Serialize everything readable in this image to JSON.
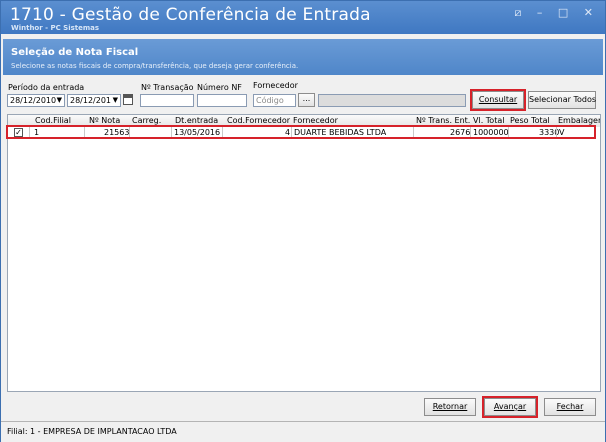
{
  "window": {
    "title": "1710 - Gestão de Conferência de Entrada",
    "subtitle": "Winthor - PC Sistemas",
    "controls": [
      "⧄",
      "–",
      "□",
      "✕"
    ]
  },
  "section": {
    "title": "Seleção de Nota Fiscal",
    "description": "Selecione as notas fiscais de compra/transferência, que deseja gerar conferência."
  },
  "filters": {
    "periodo_label": "Período da entrada",
    "date_start": "28/12/2010",
    "date_end": "28/12/201",
    "transacao_label": "Nº Transação",
    "transacao_value": "",
    "numero_nf_label": "Número NF",
    "numero_nf_value": "",
    "fornecedor_label": "Fornecedor",
    "fornecedor_placeholder": "Código",
    "ellipsis": "...",
    "fornecedor_name": ""
  },
  "buttons": {
    "consultar": "Consultar",
    "selecionar_todos": "Selecionar Todos",
    "retornar": "Retornar",
    "avancar": "Avançar",
    "fechar": "Fechar"
  },
  "table": {
    "columns": [
      "Cod.Filial",
      "Nº Nota",
      "Carreg.",
      "Dt.entrada",
      "Cod.Fornecedor",
      "Fornecedor",
      "Nº Trans. Ent.",
      "Vl. Total",
      "Peso Total",
      "Embalagem"
    ],
    "rows": [
      {
        "checked": true,
        "cod_filial": "1",
        "nota": "21563",
        "carreg": "",
        "dt_entrada": "13/05/2016",
        "cod_fornecedor": "4",
        "fornecedor": "DUARTE BEBIDAS LTDA",
        "trans_ent": "2676",
        "vl_total": "1000000",
        "peso_total": "3330",
        "embalagem": "V"
      }
    ]
  },
  "status": {
    "text": "Filial: 1 - EMPRESA DE IMPLANTACAO LTDA"
  },
  "colors": {
    "titlebar": "#3f78c2",
    "header": "#4f86c9",
    "highlight": "#d6222a"
  }
}
